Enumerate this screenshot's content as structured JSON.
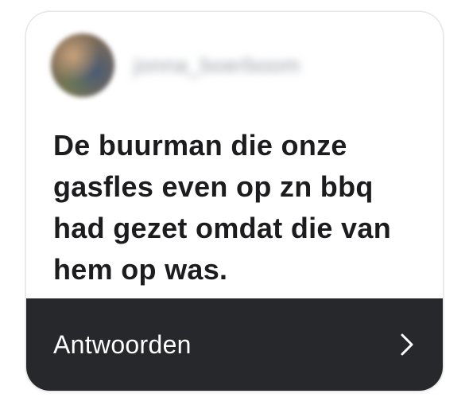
{
  "card": {
    "author": {
      "avatar_icon": "user-avatar",
      "username": "jonna_boerboom"
    },
    "message": "De buurman die onze gasfles even op zn bbq had gezet omdat die van hem op was.",
    "reply": {
      "label": "Antwoorden",
      "icon": "chevron-right-icon"
    }
  }
}
